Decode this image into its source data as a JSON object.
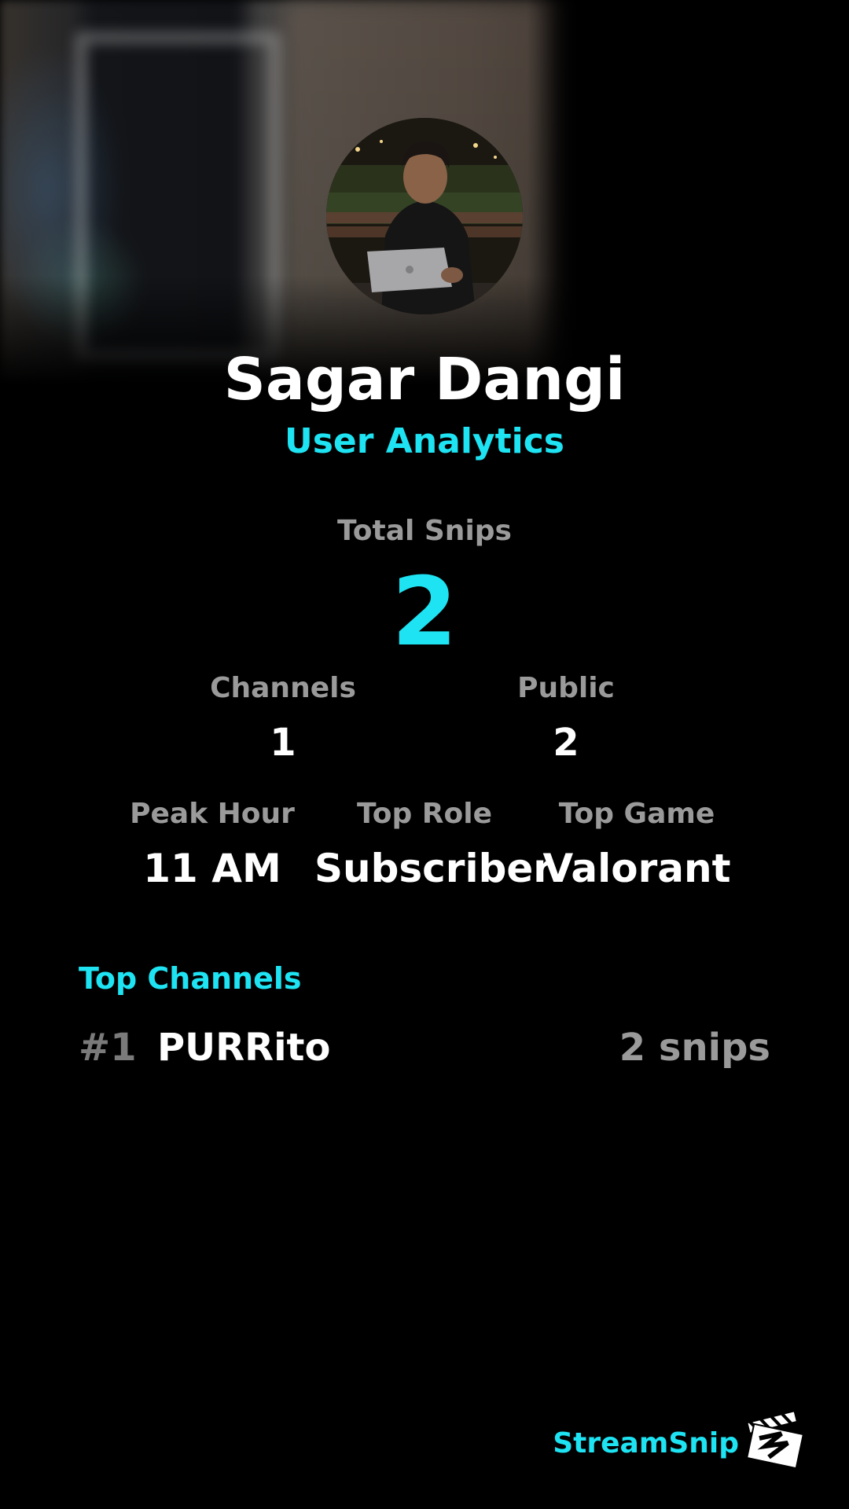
{
  "profile": {
    "name": "Sagar Dangi",
    "subtitle": "User Analytics"
  },
  "stats": {
    "total_snips_label": "Total Snips",
    "total_snips_value": "2",
    "channels_label": "Channels",
    "channels_value": "1",
    "public_label": "Public",
    "public_value": "2",
    "peak_hour_label": "Peak Hour",
    "peak_hour_value": "11 AM",
    "top_role_label": "Top Role",
    "top_role_value": "Subscriber",
    "top_game_label": "Top Game",
    "top_game_value": "Valorant"
  },
  "top_channels": {
    "title": "Top Channels",
    "items": [
      {
        "rank": "#1",
        "name": "PURRito",
        "count": "2 snips"
      }
    ]
  },
  "brand": {
    "name": "StreamSnip",
    "icon": "clapperboard-logo-icon"
  },
  "colors": {
    "accent": "#1ee3f2",
    "muted": "#9a9a9a",
    "background": "#000000"
  }
}
